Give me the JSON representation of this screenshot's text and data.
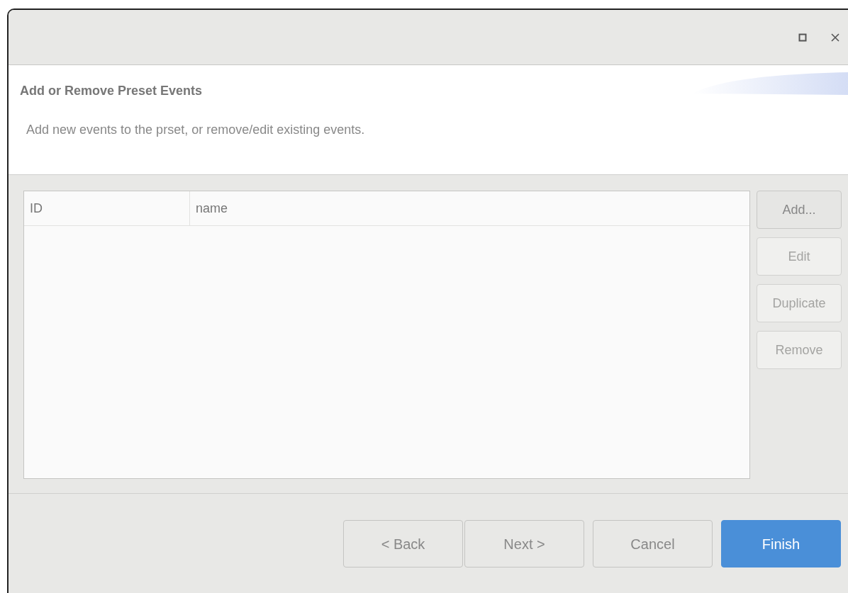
{
  "window": {
    "controls": [
      {
        "kind": "maximize"
      },
      {
        "kind": "close"
      }
    ]
  },
  "header": {
    "title": "Add or Remove Preset Events",
    "description": "Add new events to the prset, or remove/edit existing events."
  },
  "table": {
    "columns": [
      "ID",
      "name"
    ]
  },
  "side_buttons": [
    {
      "label": "Add...",
      "disabled": false
    },
    {
      "label": "Edit",
      "disabled": true
    },
    {
      "label": "Duplicate",
      "disabled": true
    },
    {
      "label": "Remove",
      "disabled": true
    }
  ],
  "footer_buttons": [
    {
      "label": "< Back",
      "kind": "default"
    },
    {
      "label": "Next >",
      "kind": "default"
    },
    {
      "label": "Cancel",
      "kind": "default"
    },
    {
      "label": "Finish",
      "kind": "primary"
    }
  ]
}
